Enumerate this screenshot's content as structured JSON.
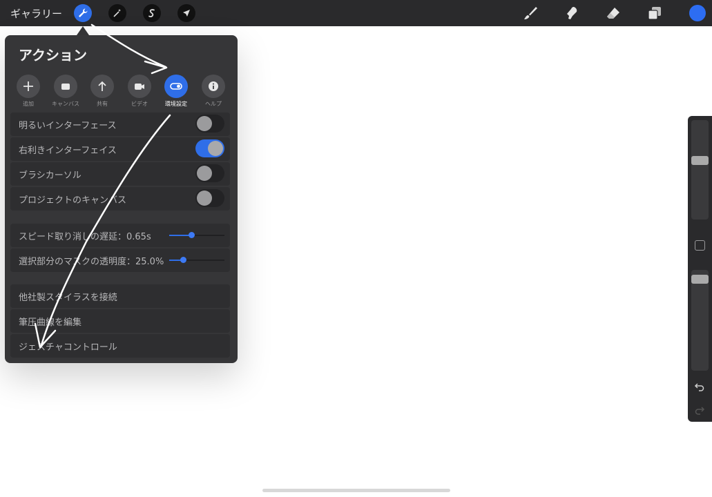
{
  "topbar": {
    "gallery_label": "ギャラリー",
    "left_tools": [
      {
        "name": "wrench-icon",
        "active": true
      },
      {
        "name": "magic-wand-icon",
        "active": false
      },
      {
        "name": "selection-icon",
        "active": false
      },
      {
        "name": "transform-arrow-icon",
        "active": false
      }
    ],
    "right_tools": [
      "brush-icon",
      "smudge-icon",
      "eraser-icon",
      "layers-icon"
    ],
    "current_color": "#2d6df2"
  },
  "actions": {
    "title": "アクション",
    "tabs": [
      {
        "label": "追加",
        "icon": "plus-icon",
        "active": false
      },
      {
        "label": "キャンバス",
        "icon": "canvas-icon",
        "active": false
      },
      {
        "label": "共有",
        "icon": "share-icon",
        "active": false
      },
      {
        "label": "ビデオ",
        "icon": "video-icon",
        "active": false
      },
      {
        "label": "環境設定",
        "icon": "toggle-icon",
        "active": true
      },
      {
        "label": "ヘルプ",
        "icon": "info-icon",
        "active": false
      }
    ],
    "toggles": [
      {
        "label": "明るいインターフェース",
        "on": false
      },
      {
        "label": "右利きインターフェイス",
        "on": true
      },
      {
        "label": "ブラシカーソル",
        "on": false
      },
      {
        "label": "プロジェクトのキャンバス",
        "on": false
      }
    ],
    "sliders": [
      {
        "label": "スピード取り消しの遅延：0.65s",
        "value": 0.4
      },
      {
        "label": "選択部分のマスクの透明度：25.0%",
        "value": 0.25
      }
    ],
    "links": [
      {
        "label": "他社製スタイラスを接続"
      },
      {
        "label": "筆圧曲線を編集"
      },
      {
        "label": "ジェスチャコントロール"
      }
    ]
  },
  "sidebar": {
    "brush_size": 0.4,
    "opacity": 0.05
  },
  "colors": {
    "accent": "#2f6ee8",
    "panel": "#363638",
    "row": "#2e2e30"
  }
}
